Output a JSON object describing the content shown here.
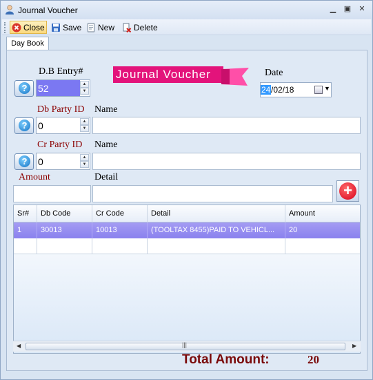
{
  "window": {
    "title": "Journal Voucher"
  },
  "toolbar": {
    "close": "Close",
    "save": "Save",
    "new": "New",
    "delete": "Delete"
  },
  "tabs": [
    {
      "label": "Day Book"
    }
  ],
  "form": {
    "db_entry_label": "D.B Entry#",
    "db_entry_value": "52",
    "banner": "Journal Voucher",
    "date_label": "Date",
    "date_selected": "24",
    "date_rest": "/02/18",
    "db_party_label": "Db Party ID",
    "db_party_value": "0",
    "db_name_label": "Name",
    "db_name_value": "",
    "cr_party_label": "Cr Party ID",
    "cr_party_value": "0",
    "cr_name_label": "Name",
    "cr_name_value": "",
    "amount_label": "Amount",
    "amount_value": "",
    "detail_label": "Detail",
    "detail_value": ""
  },
  "grid": {
    "columns": [
      "Sr#",
      "Db Code",
      "Cr Code",
      "Detail",
      "Amount"
    ],
    "rows": [
      [
        "1",
        "30013",
        "10013",
        "(TOOLTAX 8455)PAID TO VEHICL...",
        "20"
      ]
    ]
  },
  "footer": {
    "total_label": "Total Amount:",
    "total_value": "20"
  },
  "colors": {
    "banner": "#e3137b",
    "selected_row": "#8a81ee",
    "total": "#7a0a0a",
    "label_red": "#8b0000"
  }
}
